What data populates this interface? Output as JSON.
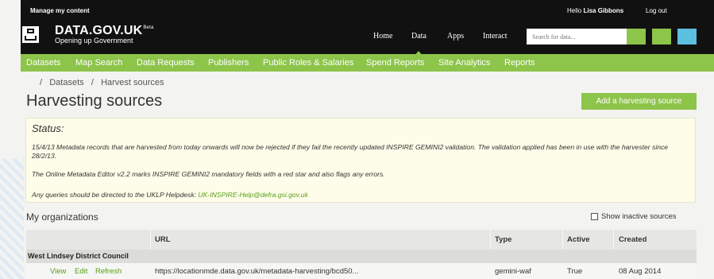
{
  "topbar": {
    "manage": "Manage my content",
    "hello_prefix": "Hello",
    "user_name": "Lisa Gibbons",
    "logout": "Log out"
  },
  "logo": {
    "title": "DATA.GOV.UK",
    "beta": "Beta",
    "subtitle": "Opening up Government"
  },
  "nav": [
    "Home",
    "Data",
    "Apps",
    "Interact"
  ],
  "nav_active": "Data",
  "search": {
    "placeholder": "Search for data..."
  },
  "header_squares": [
    "#8dc44a",
    "#5bbfe0"
  ],
  "greenbar": [
    "Datasets",
    "Map Search",
    "Data Requests",
    "Publishers",
    "Public Roles & Salaries",
    "Spend Reports",
    "Site Analytics",
    "Reports"
  ],
  "breadcrumb": {
    "sep": "/",
    "items": [
      "Datasets",
      "Harvest sources"
    ]
  },
  "page_title": "Harvesting sources",
  "add_button": "Add a harvesting source",
  "status": {
    "heading": "Status:",
    "line1": "15/4/13 Metadata records that are harvested from today onwards will now be rejected if they fail the recently updated INSPIRE GEMINI2 validation. The validation applied has been in use with the harvester since 28/2/13.",
    "line2": "The Online Metadata Editor v2.2 marks INSPIRE GEMINI2 mandatory fields with a red star and also flags any errors.",
    "line3_prefix": "Any queries should be directed to the UKLP Helpdesk: ",
    "email": "UK-INSPIRE-Help@defra.gsi.gov.uk"
  },
  "orgs": {
    "heading": "My organizations",
    "show_inactive": "Show inactive sources",
    "columns": [
      "URL",
      "Type",
      "Active",
      "Created"
    ],
    "group": "West Lindsey District Council",
    "row": {
      "actions": [
        "View",
        "Edit",
        "Refresh"
      ],
      "url": "https://locationmde.data.gov.uk/metadata-harvesting/bcd50...",
      "type": "gemini-waf",
      "active": "True",
      "created": "08 Aug 2014"
    }
  }
}
